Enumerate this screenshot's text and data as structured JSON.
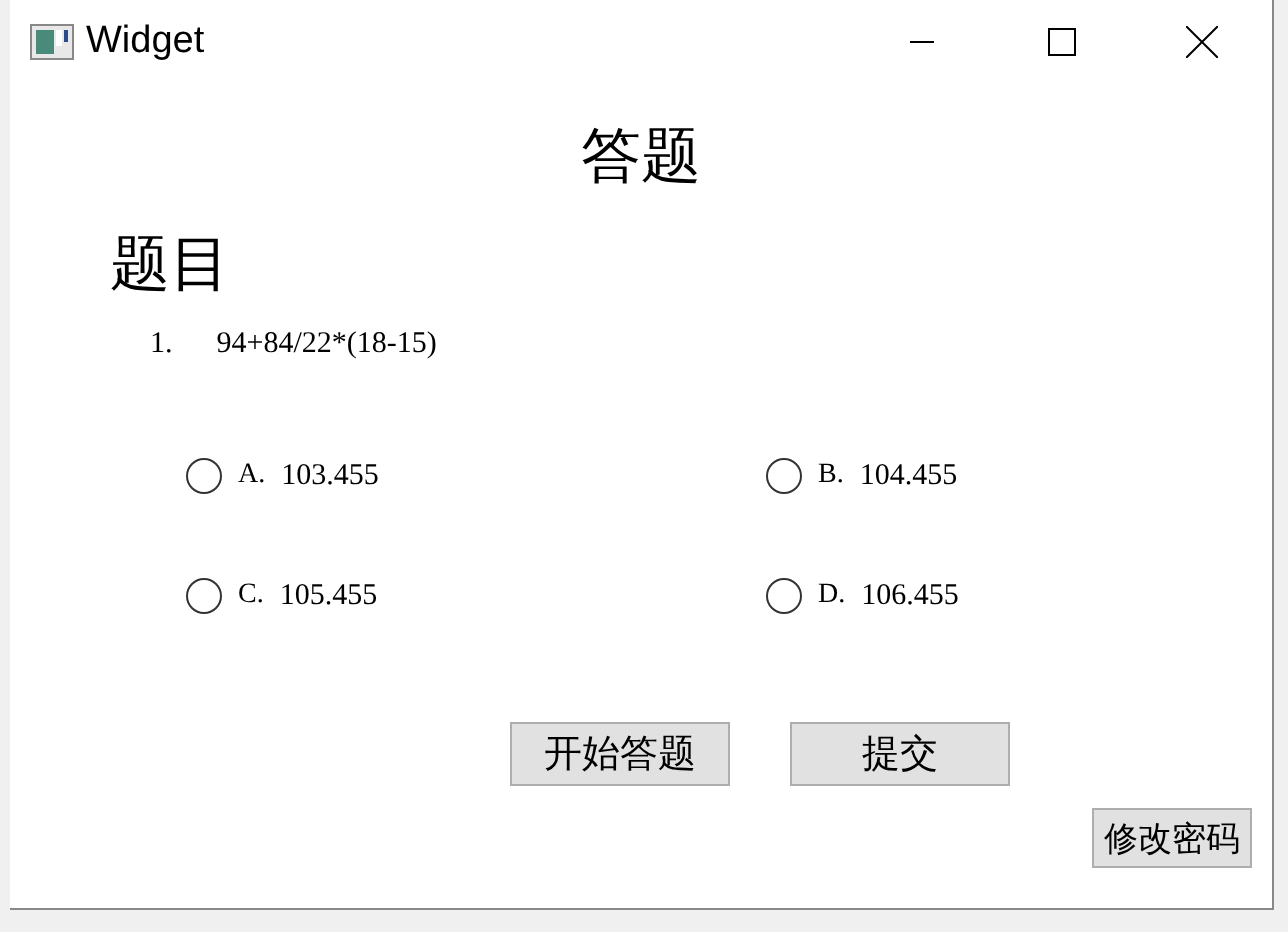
{
  "window": {
    "title": "Widget"
  },
  "heading": "答题",
  "section_title": "题目",
  "question": {
    "number": "1.",
    "text": "94+84/22*(18-15)"
  },
  "options": [
    {
      "letter": "A.",
      "value": "103.455",
      "selected": false
    },
    {
      "letter": "B.",
      "value": "104.455",
      "selected": false
    },
    {
      "letter": "C.",
      "value": "105.455",
      "selected": false
    },
    {
      "letter": "D.",
      "value": "106.455",
      "selected": false
    }
  ],
  "buttons": [
    "开始答题",
    "提交"
  ],
  "corner_button": "修改密码"
}
